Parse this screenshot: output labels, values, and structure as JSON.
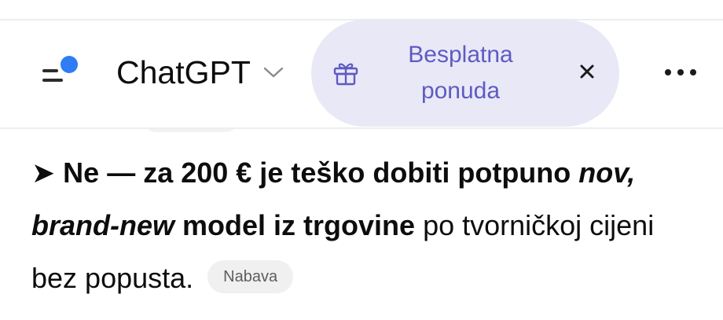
{
  "header": {
    "title": "ChatGPT",
    "menu_icon": "sidebar-menu-icon",
    "offer": {
      "icon": "gift-icon",
      "label_line1": "Besplatna",
      "label_line2": "ponuda",
      "close_icon": "close-icon"
    },
    "more_icon": "more-horizontal-icon"
  },
  "message": {
    "line1": {
      "arrow": "➤",
      "bold": " Ne — za 200 € je teško dobiti potpuno ",
      "italic_bold": "nov,"
    },
    "line2": {
      "italic_bold": "brand-new",
      "bold": " model iz trgovine",
      "normal": " po tvorničkoj cijeni"
    },
    "line3": {
      "normal": "bez popusta.",
      "badge": "Nabava"
    }
  },
  "colors": {
    "accent_dot": "#2f7cf6",
    "offer_bg": "#e9e8f7",
    "offer_text": "#5e5bc2",
    "badge_bg": "#f0f0f0"
  }
}
